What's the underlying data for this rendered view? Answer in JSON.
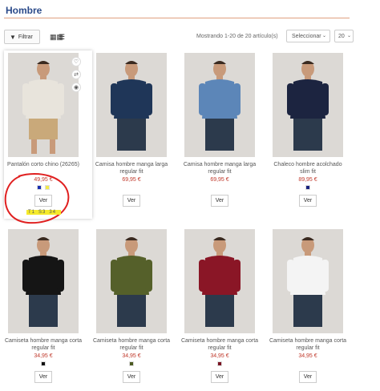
{
  "page": {
    "title": "Hombre"
  },
  "toolbar": {
    "filter_label": "Filtrar",
    "filter_icon": "filter-icon",
    "grid_icon": "grid-view-icon",
    "list_icon": "list-view-icon",
    "showing_text": "Mostrando 1-20 de 20 artículo(s)",
    "sort_value": "Seleccionar",
    "per_page_value": "20"
  },
  "products": [
    {
      "name": "Pantalón corto chino (26265)",
      "price": "49,95 €",
      "swatches": [
        "#1a2fb0",
        "#f2e94a"
      ],
      "button": "Ver",
      "sizes": [
        "T1",
        "S3",
        "34"
      ],
      "shirt": "#e8e4dc",
      "pants": "#c9a97a"
    },
    {
      "name": "Camisa hombre manga larga regular fit",
      "price": "69,95 €",
      "swatches": [],
      "button": "Ver",
      "shirt": "#1f3658",
      "pants": "#2c3a4c"
    },
    {
      "name": "Camisa hombre manga larga regular fit",
      "price": "69,95 €",
      "swatches": [],
      "button": "Ver",
      "shirt": "#5c86b8",
      "pants": "#2c3a4c"
    },
    {
      "name": "Chaleco hombre acolchado slim fit",
      "price": "89,95 €",
      "swatches": [
        "#1a237e"
      ],
      "button": "Ver",
      "shirt": "#1c2440",
      "pants": "#2c3a4c"
    },
    {
      "name": "Camiseta hombre manga corta regular fit",
      "price": "34,95 €",
      "swatches": [
        "#111111"
      ],
      "button": "Ver",
      "shirt": "#151515",
      "pants": "#2c3a4c"
    },
    {
      "name": "Camiseta hombre manga corta regular fit",
      "price": "34,95 €",
      "swatches": [
        "#4c5a22"
      ],
      "button": "Ver",
      "shirt": "#55602a",
      "pants": "#2c3a4c"
    },
    {
      "name": "Camiseta hombre manga corta regular fit",
      "price": "34,95 €",
      "swatches": [
        "#7a1422"
      ],
      "button": "Ver",
      "shirt": "#8a1626",
      "pants": "#2c3a4c"
    },
    {
      "name": "Camiseta hombre manga corta regular fit",
      "price": "34,95 €",
      "swatches": [],
      "button": "Ver",
      "shirt": "#f4f4f4",
      "pants": "#2c3a4c"
    }
  ],
  "quick_icons": [
    "heart-icon",
    "shuffle-icon",
    "eye-icon"
  ]
}
